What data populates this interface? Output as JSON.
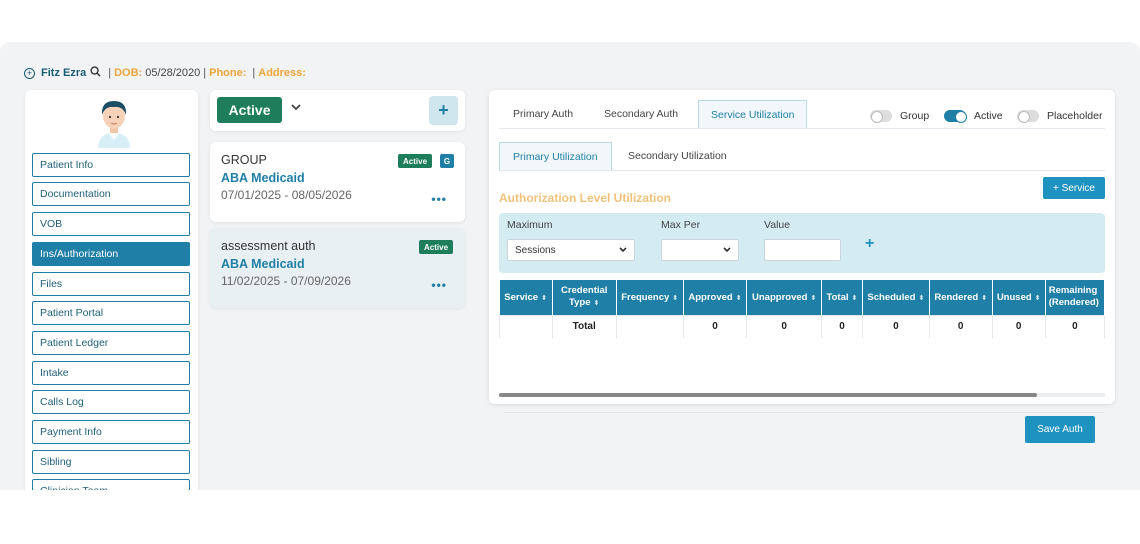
{
  "header": {
    "patient_name": "Fitz Ezra",
    "separator": "|",
    "dob_label": "DOB:",
    "dob_value": "05/28/2020",
    "phone_label": "Phone:",
    "phone_value": "",
    "address_label": "Address:",
    "address_value": ""
  },
  "sidebar": {
    "items": [
      {
        "label": "Patient Info",
        "active": false
      },
      {
        "label": "Documentation",
        "active": false
      },
      {
        "label": "VOB",
        "active": false
      },
      {
        "label": "Ins/Authorization",
        "active": true
      },
      {
        "label": "Files",
        "active": false
      },
      {
        "label": "Patient Portal",
        "active": false
      },
      {
        "label": "Patient Ledger",
        "active": false
      },
      {
        "label": "Intake",
        "active": false
      },
      {
        "label": "Calls Log",
        "active": false
      },
      {
        "label": "Payment Info",
        "active": false
      },
      {
        "label": "Sibling",
        "active": false
      },
      {
        "label": "Clinician Team",
        "active": false
      }
    ]
  },
  "status_filter": {
    "selected": "Active",
    "add_label": "+"
  },
  "auth_cards": [
    {
      "title": "GROUP",
      "badge": "Active",
      "group_badge": "G",
      "payer": "ABA Medicaid",
      "dates": "07/01/2025 - 08/05/2026",
      "menu": "•••"
    },
    {
      "title": "assessment auth",
      "badge": "Active",
      "payer": "ABA Medicaid",
      "dates": "11/02/2025 - 07/09/2026",
      "menu": "•••"
    }
  ],
  "panel": {
    "tabs": [
      "Primary Auth",
      "Secondary Auth",
      "Service Utilization"
    ],
    "active_tab": "Service Utilization",
    "toggles": [
      {
        "label": "Group",
        "on": false
      },
      {
        "label": "Active",
        "on": true
      },
      {
        "label": "Placeholder",
        "on": false
      }
    ],
    "subtabs": [
      "Primary Utilization",
      "Secondary Utilization"
    ],
    "active_subtab": "Primary Utilization",
    "section_title": "Authorization Level Utilization",
    "add_service_label": "+ Service",
    "filters": {
      "maximum_label": "Maximum",
      "maximum_value": "Sessions",
      "max_per_label": "Max Per",
      "max_per_value": "",
      "value_label": "Value",
      "value_value": "",
      "add_label": "+"
    },
    "table": {
      "columns": [
        "Service",
        "Credential Type",
        "Frequency",
        "Approved",
        "Unapproved",
        "Total",
        "Scheduled",
        "Rendered",
        "Unused",
        "Remaining (Rendered)"
      ],
      "total_row": [
        "",
        "Total",
        "",
        "0",
        "0",
        "0",
        "0",
        "0",
        "0",
        "0"
      ]
    },
    "save_label": "Save Auth"
  },
  "colors": {
    "primary": "#1f7fa6",
    "active_green": "#1e7d5a",
    "accent_orange": "#f0a53a",
    "filter_bg": "#d4ebf2"
  }
}
